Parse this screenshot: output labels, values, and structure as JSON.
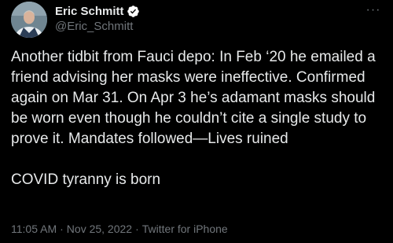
{
  "author": {
    "display_name": "Eric Schmitt",
    "handle": "@Eric_Schmitt",
    "verified": true,
    "avatar_icon": "profile-photo"
  },
  "more_menu": {
    "icon": "more-horizontal-icon",
    "glyph": "···"
  },
  "tweet": {
    "text": "Another tidbit from Fauci depo: In Feb ‘20 he emailed a friend advising her masks were ineffective. Confirmed again on Mar 31. On Apr 3 he’s adamant masks should be worn even though he couldn’t cite a single study to prove it. Mandates followed—Lives ruined\n\nCOVID tyranny is born"
  },
  "meta": {
    "time": "11:05 AM",
    "separator": "·",
    "date": "Nov 25, 2022",
    "source": "Twitter for iPhone"
  },
  "colors": {
    "background": "#000000",
    "primary_text": "#e7e9ea",
    "secondary_text": "#71767b",
    "verified_badge": "#ffffff"
  }
}
